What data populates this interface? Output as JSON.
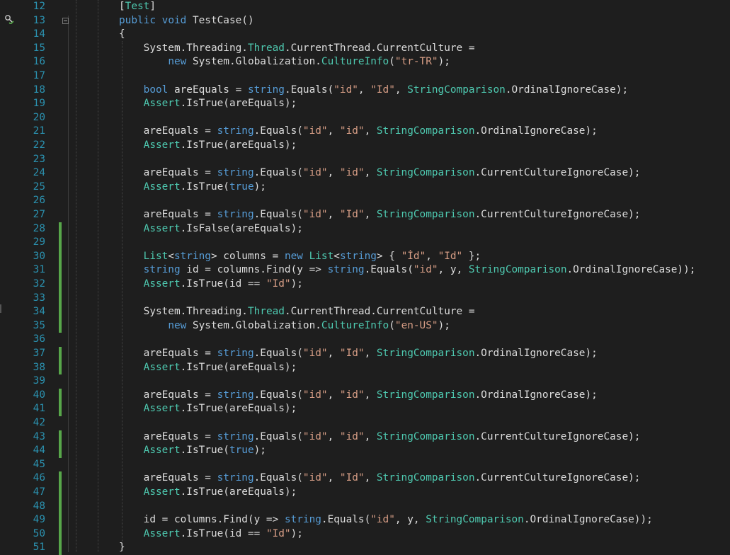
{
  "editor": {
    "title": "",
    "change_marker_color": "#57a64a",
    "glyph_margin_icon": "test-run-icon",
    "lines": [
      {
        "num": "12",
        "changed": false,
        "tokens": [
          [
            "pl",
            "["
          ],
          [
            "ty",
            "Test"
          ],
          [
            "pl",
            "]"
          ]
        ],
        "indent": 0
      },
      {
        "num": "13",
        "changed": false,
        "tokens": [
          [
            "kw",
            "public"
          ],
          [
            "pl",
            " "
          ],
          [
            "kw",
            "void"
          ],
          [
            "pl",
            " TestCase()"
          ]
        ],
        "indent": 0
      },
      {
        "num": "14",
        "changed": false,
        "tokens": [
          [
            "pl",
            "{"
          ]
        ],
        "indent": 0
      },
      {
        "num": "15",
        "changed": false,
        "tokens": [
          [
            "pl",
            "    System.Threading."
          ],
          [
            "ty",
            "Thread"
          ],
          [
            "pl",
            ".CurrentThread.CurrentCulture ="
          ]
        ],
        "indent": 0
      },
      {
        "num": "16",
        "changed": false,
        "tokens": [
          [
            "pl",
            "        "
          ],
          [
            "kw",
            "new"
          ],
          [
            "pl",
            " System.Globalization."
          ],
          [
            "ty",
            "CultureInfo"
          ],
          [
            "pl",
            "("
          ],
          [
            "st",
            "\"tr-TR\""
          ],
          [
            "pl",
            ");"
          ]
        ],
        "indent": 0
      },
      {
        "num": "17",
        "changed": false,
        "tokens": [],
        "indent": 0
      },
      {
        "num": "18",
        "changed": false,
        "tokens": [
          [
            "pl",
            "    "
          ],
          [
            "kw",
            "bool"
          ],
          [
            "pl",
            " areEquals = "
          ],
          [
            "kw",
            "string"
          ],
          [
            "pl",
            ".Equals("
          ],
          [
            "st",
            "\"id\""
          ],
          [
            "pl",
            ", "
          ],
          [
            "st",
            "\"Id\""
          ],
          [
            "pl",
            ", "
          ],
          [
            "ty",
            "StringComparison"
          ],
          [
            "pl",
            ".OrdinalIgnoreCase);"
          ]
        ],
        "indent": 0
      },
      {
        "num": "19",
        "changed": false,
        "tokens": [
          [
            "pl",
            "    "
          ],
          [
            "ty",
            "Assert"
          ],
          [
            "pl",
            ".IsTrue(areEquals);"
          ]
        ],
        "indent": 0
      },
      {
        "num": "20",
        "changed": false,
        "tokens": [],
        "indent": 0
      },
      {
        "num": "21",
        "changed": false,
        "tokens": [
          [
            "pl",
            "    areEquals = "
          ],
          [
            "kw",
            "string"
          ],
          [
            "pl",
            ".Equals("
          ],
          [
            "st",
            "\"id\""
          ],
          [
            "pl",
            ", "
          ],
          [
            "st",
            "\"id\""
          ],
          [
            "pl",
            ", "
          ],
          [
            "ty",
            "StringComparison"
          ],
          [
            "pl",
            ".OrdinalIgnoreCase);"
          ]
        ],
        "indent": 0
      },
      {
        "num": "22",
        "changed": false,
        "tokens": [
          [
            "pl",
            "    "
          ],
          [
            "ty",
            "Assert"
          ],
          [
            "pl",
            ".IsTrue(areEquals);"
          ]
        ],
        "indent": 0
      },
      {
        "num": "23",
        "changed": false,
        "tokens": [],
        "indent": 0
      },
      {
        "num": "24",
        "changed": false,
        "tokens": [
          [
            "pl",
            "    areEquals = "
          ],
          [
            "kw",
            "string"
          ],
          [
            "pl",
            ".Equals("
          ],
          [
            "st",
            "\"id\""
          ],
          [
            "pl",
            ", "
          ],
          [
            "st",
            "\"id\""
          ],
          [
            "pl",
            ", "
          ],
          [
            "ty",
            "StringComparison"
          ],
          [
            "pl",
            ".CurrentCultureIgnoreCase);"
          ]
        ],
        "indent": 0
      },
      {
        "num": "25",
        "changed": false,
        "tokens": [
          [
            "pl",
            "    "
          ],
          [
            "ty",
            "Assert"
          ],
          [
            "pl",
            ".IsTrue("
          ],
          [
            "kw",
            "true"
          ],
          [
            "pl",
            ");"
          ]
        ],
        "indent": 0
      },
      {
        "num": "26",
        "changed": false,
        "tokens": [],
        "indent": 0
      },
      {
        "num": "27",
        "changed": false,
        "tokens": [
          [
            "pl",
            "    areEquals = "
          ],
          [
            "kw",
            "string"
          ],
          [
            "pl",
            ".Equals("
          ],
          [
            "st",
            "\"id\""
          ],
          [
            "pl",
            ", "
          ],
          [
            "st",
            "\"Id\""
          ],
          [
            "pl",
            ", "
          ],
          [
            "ty",
            "StringComparison"
          ],
          [
            "pl",
            ".CurrentCultureIgnoreCase);"
          ]
        ],
        "indent": 0
      },
      {
        "num": "28",
        "changed": true,
        "tokens": [
          [
            "pl",
            "    "
          ],
          [
            "ty",
            "Assert"
          ],
          [
            "pl",
            ".IsFalse(areEquals);"
          ]
        ],
        "indent": 0
      },
      {
        "num": "29",
        "changed": true,
        "tokens": [],
        "indent": 0
      },
      {
        "num": "30",
        "changed": true,
        "tokens": [
          [
            "pl",
            "    "
          ],
          [
            "ty",
            "List"
          ],
          [
            "pl",
            "<"
          ],
          [
            "kw",
            "string"
          ],
          [
            "pl",
            "> columns = "
          ],
          [
            "kw",
            "new"
          ],
          [
            "pl",
            " "
          ],
          [
            "ty",
            "List"
          ],
          [
            "pl",
            "<"
          ],
          [
            "kw",
            "string"
          ],
          [
            "pl",
            "> { "
          ],
          [
            "st",
            "\"İd\""
          ],
          [
            "pl",
            ", "
          ],
          [
            "st",
            "\"Id\""
          ],
          [
            "pl",
            " };"
          ]
        ],
        "indent": 0
      },
      {
        "num": "31",
        "changed": true,
        "tokens": [
          [
            "pl",
            "    "
          ],
          [
            "kw",
            "string"
          ],
          [
            "pl",
            " id = columns.Find(y => "
          ],
          [
            "kw",
            "string"
          ],
          [
            "pl",
            ".Equals("
          ],
          [
            "st",
            "\"id\""
          ],
          [
            "pl",
            ", y, "
          ],
          [
            "ty",
            "StringComparison"
          ],
          [
            "pl",
            ".OrdinalIgnoreCase));"
          ]
        ],
        "indent": 0
      },
      {
        "num": "32",
        "changed": true,
        "tokens": [
          [
            "pl",
            "    "
          ],
          [
            "ty",
            "Assert"
          ],
          [
            "pl",
            ".IsTrue(id == "
          ],
          [
            "st",
            "\"Id\""
          ],
          [
            "pl",
            ");"
          ]
        ],
        "indent": 0
      },
      {
        "num": "33",
        "changed": true,
        "tokens": [],
        "indent": 0
      },
      {
        "num": "34",
        "changed": true,
        "tokens": [
          [
            "pl",
            "    System.Threading."
          ],
          [
            "ty",
            "Thread"
          ],
          [
            "pl",
            ".CurrentThread.CurrentCulture ="
          ]
        ],
        "indent": 0
      },
      {
        "num": "35",
        "changed": true,
        "tokens": [
          [
            "pl",
            "        "
          ],
          [
            "kw",
            "new"
          ],
          [
            "pl",
            " System.Globalization."
          ],
          [
            "ty",
            "CultureInfo"
          ],
          [
            "pl",
            "("
          ],
          [
            "st",
            "\"en-US\""
          ],
          [
            "pl",
            ");"
          ]
        ],
        "indent": 0
      },
      {
        "num": "36",
        "changed": false,
        "tokens": [],
        "indent": 0
      },
      {
        "num": "37",
        "changed": true,
        "tokens": [
          [
            "pl",
            "    areEquals = "
          ],
          [
            "kw",
            "string"
          ],
          [
            "pl",
            ".Equals("
          ],
          [
            "st",
            "\"id\""
          ],
          [
            "pl",
            ", "
          ],
          [
            "st",
            "\"Id\""
          ],
          [
            "pl",
            ", "
          ],
          [
            "ty",
            "StringComparison"
          ],
          [
            "pl",
            ".OrdinalIgnoreCase);"
          ]
        ],
        "indent": 0
      },
      {
        "num": "38",
        "changed": true,
        "tokens": [
          [
            "pl",
            "    "
          ],
          [
            "ty",
            "Assert"
          ],
          [
            "pl",
            ".IsTrue(areEquals);"
          ]
        ],
        "indent": 0
      },
      {
        "num": "39",
        "changed": false,
        "tokens": [],
        "indent": 0
      },
      {
        "num": "40",
        "changed": true,
        "tokens": [
          [
            "pl",
            "    areEquals = "
          ],
          [
            "kw",
            "string"
          ],
          [
            "pl",
            ".Equals("
          ],
          [
            "st",
            "\"id\""
          ],
          [
            "pl",
            ", "
          ],
          [
            "st",
            "\"id\""
          ],
          [
            "pl",
            ", "
          ],
          [
            "ty",
            "StringComparison"
          ],
          [
            "pl",
            ".OrdinalIgnoreCase);"
          ]
        ],
        "indent": 0
      },
      {
        "num": "41",
        "changed": true,
        "tokens": [
          [
            "pl",
            "    "
          ],
          [
            "ty",
            "Assert"
          ],
          [
            "pl",
            ".IsTrue(areEquals);"
          ]
        ],
        "indent": 0
      },
      {
        "num": "42",
        "changed": false,
        "tokens": [],
        "indent": 0
      },
      {
        "num": "43",
        "changed": true,
        "tokens": [
          [
            "pl",
            "    areEquals = "
          ],
          [
            "kw",
            "string"
          ],
          [
            "pl",
            ".Equals("
          ],
          [
            "st",
            "\"id\""
          ],
          [
            "pl",
            ", "
          ],
          [
            "st",
            "\"id\""
          ],
          [
            "pl",
            ", "
          ],
          [
            "ty",
            "StringComparison"
          ],
          [
            "pl",
            ".CurrentCultureIgnoreCase);"
          ]
        ],
        "indent": 0
      },
      {
        "num": "44",
        "changed": true,
        "tokens": [
          [
            "pl",
            "    "
          ],
          [
            "ty",
            "Assert"
          ],
          [
            "pl",
            ".IsTrue("
          ],
          [
            "kw",
            "true"
          ],
          [
            "pl",
            ");"
          ]
        ],
        "indent": 0
      },
      {
        "num": "45",
        "changed": false,
        "tokens": [],
        "indent": 0
      },
      {
        "num": "46",
        "changed": true,
        "tokens": [
          [
            "pl",
            "    areEquals = "
          ],
          [
            "kw",
            "string"
          ],
          [
            "pl",
            ".Equals("
          ],
          [
            "st",
            "\"id\""
          ],
          [
            "pl",
            ", "
          ],
          [
            "st",
            "\"Id\""
          ],
          [
            "pl",
            ", "
          ],
          [
            "ty",
            "StringComparison"
          ],
          [
            "pl",
            ".CurrentCultureIgnoreCase);"
          ]
        ],
        "indent": 0
      },
      {
        "num": "47",
        "changed": true,
        "tokens": [
          [
            "pl",
            "    "
          ],
          [
            "ty",
            "Assert"
          ],
          [
            "pl",
            ".IsTrue(areEquals);"
          ]
        ],
        "indent": 0
      },
      {
        "num": "48",
        "changed": true,
        "tokens": [],
        "indent": 0
      },
      {
        "num": "49",
        "changed": true,
        "tokens": [
          [
            "pl",
            "    id = columns.Find(y => "
          ],
          [
            "kw",
            "string"
          ],
          [
            "pl",
            ".Equals("
          ],
          [
            "st",
            "\"id\""
          ],
          [
            "pl",
            ", y, "
          ],
          [
            "ty",
            "StringComparison"
          ],
          [
            "pl",
            ".OrdinalIgnoreCase));"
          ]
        ],
        "indent": 0
      },
      {
        "num": "50",
        "changed": true,
        "tokens": [
          [
            "pl",
            "    "
          ],
          [
            "ty",
            "Assert"
          ],
          [
            "pl",
            ".IsTrue(id == "
          ],
          [
            "st",
            "\"Id\""
          ],
          [
            "pl",
            ");"
          ]
        ],
        "indent": 0
      },
      {
        "num": "51",
        "changed": true,
        "tokens": [
          [
            "pl",
            "}"
          ]
        ],
        "indent": 0
      }
    ]
  }
}
